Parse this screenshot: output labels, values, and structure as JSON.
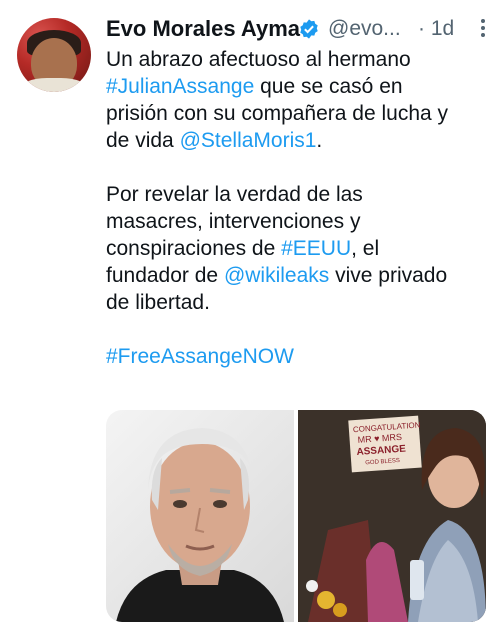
{
  "tweet": {
    "author_name": "Evo Morales Ayma",
    "handle": "@evo...",
    "time": "· 1d",
    "paragraphs": {
      "p1": {
        "line1": "Un abrazo afectuoso al hermano",
        "hashtag": "#JulianAssange",
        "line2_rest": " que se casó en",
        "line3": "prisión con su compañera de lucha y",
        "line4_pre": "de vida ",
        "mention": "@StellaMoris1",
        "line4_post": "."
      },
      "p2": {
        "line1": "Por revelar la verdad de las",
        "line2": "masacres, intervenciones y",
        "line3_pre": "conspiraciones de ",
        "hashtag": "#EEUU",
        "line3_post": ", el",
        "line4_pre": "fundador de ",
        "mention": "@wikileaks",
        "line4_post": " vive privado",
        "line5": "de libertad."
      },
      "p3": {
        "hashtag": "#FreeAssangeNOW"
      }
    },
    "sign": {
      "l1": "CONGATULATION",
      "l2": "MR ♥ MRS",
      "l3": "ASSANGE",
      "l4": "GOD BLESS"
    }
  },
  "colors": {
    "link": "#1d9bf0",
    "text": "#0f1419",
    "muted": "#536471",
    "verified": "#1d9bf0"
  },
  "icons": [
    "verified-badge-icon",
    "more-options-icon"
  ]
}
